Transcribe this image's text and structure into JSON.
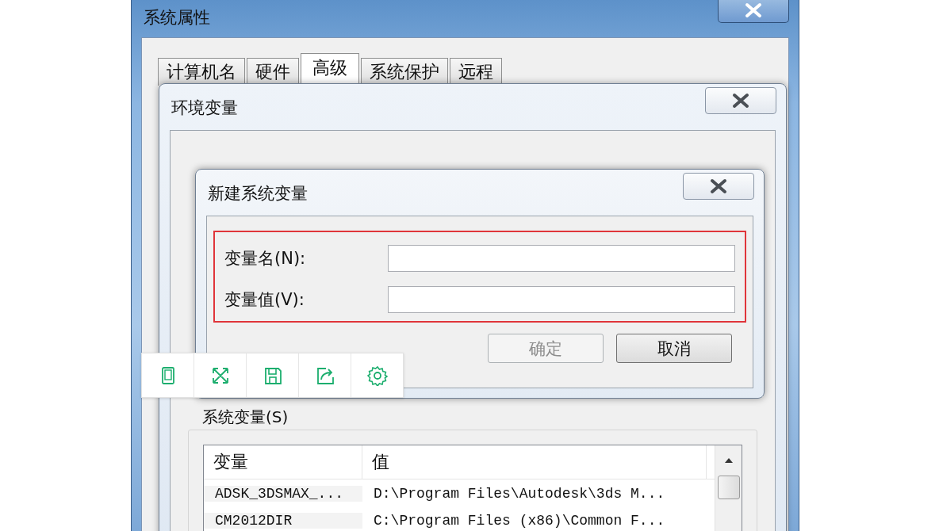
{
  "window": {
    "title": "系统属性"
  },
  "tabs": [
    {
      "label": "计算机名",
      "selected": false
    },
    {
      "label": "硬件",
      "selected": false
    },
    {
      "label": "高级",
      "selected": true
    },
    {
      "label": "系统保护",
      "selected": false
    },
    {
      "label": "远程",
      "selected": false
    }
  ],
  "env_dialog": {
    "title": "环境变量",
    "system_variables": {
      "label": "系统变量(S)",
      "columns": [
        "变量",
        "值"
      ],
      "rows": [
        {
          "name": "ADSK_3DSMAX_...",
          "value": "D:\\Program Files\\Autodesk\\3ds M..."
        },
        {
          "name": "CM2012DIR",
          "value": "C:\\Program Files (x86)\\Common F..."
        }
      ]
    }
  },
  "new_dialog": {
    "title": "新建系统变量",
    "fields": [
      {
        "label": "变量名(N):"
      },
      {
        "label": "变量值(V):"
      }
    ],
    "buttons": [
      {
        "label": "确定",
        "disabled": true
      },
      {
        "label": "取消",
        "disabled": false
      }
    ]
  },
  "toolbar": [
    {
      "kind": "tablet"
    },
    {
      "kind": "fullscreen"
    },
    {
      "kind": "save"
    },
    {
      "kind": "share"
    },
    {
      "kind": "settings"
    }
  ]
}
